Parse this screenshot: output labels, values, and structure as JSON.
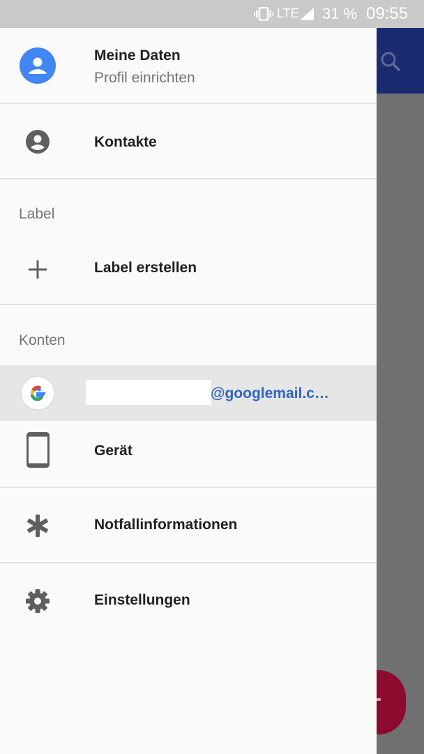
{
  "status_bar": {
    "network": "LTE",
    "battery": "31 %",
    "time": "09:55",
    "icons": [
      "vibrate-icon",
      "signal-icon"
    ]
  },
  "drawer": {
    "profile": {
      "title": "Meine Daten",
      "subtitle": "Profil einrichten",
      "avatar_color": "#4285f4"
    },
    "contacts_label": "Kontakte",
    "labels_section": {
      "header": "Label",
      "create_label": "Label erstellen"
    },
    "accounts_section": {
      "header": "Konten",
      "account_email_suffix": "@googlemail.c…",
      "device_label": "Gerät"
    },
    "emergency_label": "Notfallinformationen",
    "settings_label": "Einstellungen"
  },
  "colors": {
    "accent_blue": "#2f66c3",
    "toolbar": "#1b2b72",
    "fab": "#8d0a2f"
  }
}
